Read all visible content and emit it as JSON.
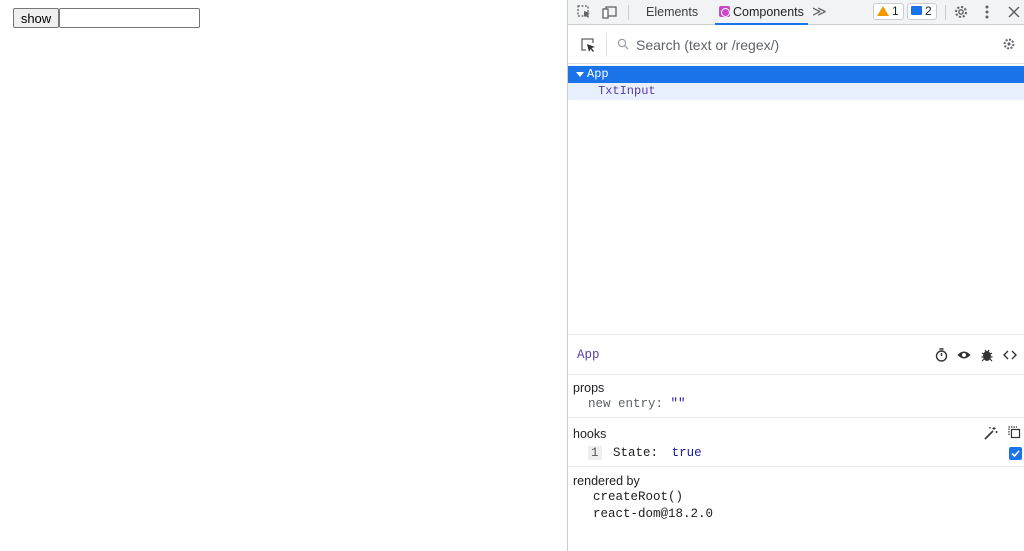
{
  "app": {
    "show_button": "show",
    "text_input_value": ""
  },
  "devtools": {
    "tabs": {
      "elements": "Elements",
      "components": "Components",
      "more": "≫"
    },
    "badges": {
      "warnings": "1",
      "messages": "2"
    },
    "search": {
      "placeholder": "Search (text or /regex/)",
      "value": ""
    },
    "tree": [
      {
        "label": "App",
        "selected": true,
        "expanded": true
      },
      {
        "label": "TxtInput",
        "selected": false
      }
    ],
    "inspector": {
      "title": "App",
      "props": {
        "title": "props",
        "items": [
          {
            "key": "new entry:",
            "value": "\"\""
          }
        ]
      },
      "hooks": {
        "title": "hooks",
        "items": [
          {
            "index": "1",
            "key": "State:",
            "value": "true"
          }
        ]
      },
      "rendered_by": {
        "title": "rendered by",
        "items": [
          "createRoot()",
          "react-dom@18.2.0"
        ]
      }
    }
  },
  "colors": {
    "accent": "#1a73e8",
    "component_name": "#5b3ca8",
    "warning": "#f29900"
  }
}
